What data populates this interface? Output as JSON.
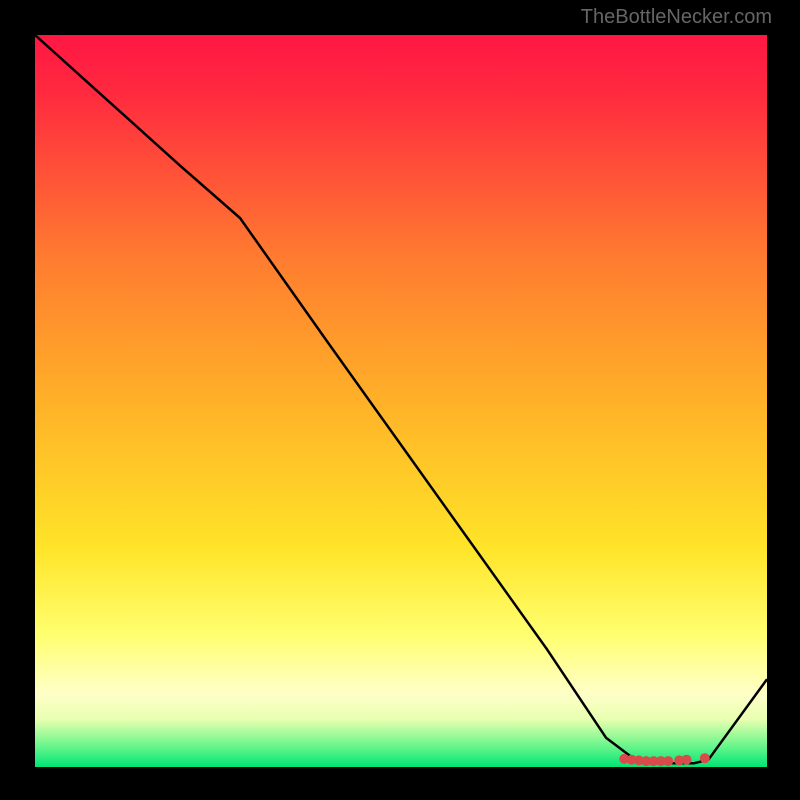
{
  "watermark": "TheBottleNecker.com",
  "chart_data": {
    "type": "line",
    "title": "",
    "xlabel": "",
    "ylabel": "",
    "xlim": [
      0,
      100
    ],
    "ylim": [
      0,
      100
    ],
    "background_gradient": {
      "stops": [
        {
          "offset": 0.0,
          "color": "#ff1744"
        },
        {
          "offset": 0.08,
          "color": "#ff2a3f"
        },
        {
          "offset": 0.3,
          "color": "#ff7a30"
        },
        {
          "offset": 0.5,
          "color": "#ffb128"
        },
        {
          "offset": 0.7,
          "color": "#ffe428"
        },
        {
          "offset": 0.82,
          "color": "#ffff70"
        },
        {
          "offset": 0.9,
          "color": "#ffffc8"
        },
        {
          "offset": 0.935,
          "color": "#e8ffb0"
        },
        {
          "offset": 0.965,
          "color": "#80f890"
        },
        {
          "offset": 1.0,
          "color": "#00e676"
        }
      ]
    },
    "series": [
      {
        "name": "curve",
        "x": [
          0,
          10,
          20,
          28,
          40,
          50,
          60,
          70,
          78,
          82,
          86,
          90,
          92,
          100
        ],
        "y": [
          100,
          91,
          82,
          75,
          58,
          44,
          30,
          16,
          4,
          1,
          0.5,
          0.5,
          1,
          12
        ]
      }
    ],
    "markers": {
      "name": "bottleneck-points",
      "x": [
        80.5,
        81.5,
        82.5,
        83.5,
        84.5,
        85.5,
        86.5,
        88.0,
        89.0,
        91.5
      ],
      "y": [
        1.1,
        1.0,
        0.9,
        0.8,
        0.8,
        0.8,
        0.8,
        0.9,
        1.0,
        1.2
      ],
      "color": "#d94a4a",
      "radius": 5
    }
  }
}
